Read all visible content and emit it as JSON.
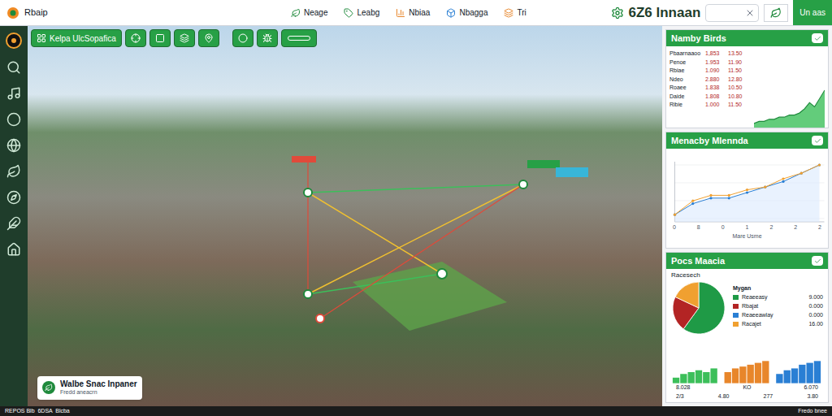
{
  "app": {
    "logo": "Rbaip"
  },
  "nav_tabs": [
    {
      "label": "Neage",
      "selected": false,
      "color": "#1f8a3c"
    },
    {
      "label": "Leabg",
      "selected": false,
      "color": "#1f8a3c"
    },
    {
      "label": "Nbiaa",
      "selected": false,
      "color": "#e8862a"
    },
    {
      "label": "Nbagga",
      "selected": false,
      "color": "#2a7fd4"
    },
    {
      "label": "Tri",
      "selected": false,
      "color": "#e8862a"
    }
  ],
  "header": {
    "title": "6Z6 lnnaan",
    "search": {
      "value": ""
    },
    "button": "Un aas"
  },
  "toolbar": {
    "primary": "Kelpa UlcSopafica"
  },
  "map_card": {
    "title": "Walbe Snac Inpaner",
    "subtitle": "Fredd aneacrn"
  },
  "card_table": {
    "title": "Namby Birds",
    "rows": [
      [
        "Pbaarnaaoo",
        "1,853",
        "13.50"
      ],
      [
        "Penoe",
        "1.953",
        "11.90"
      ],
      [
        "Rbiae",
        "1.090",
        "11.50"
      ],
      [
        "Ndeo",
        "2.880",
        "12.80"
      ],
      [
        "Roaee",
        "1.838",
        "10.50"
      ],
      [
        "Daide",
        "1.808",
        "10.80"
      ],
      [
        "Ribie",
        "1.000",
        "11.50"
      ]
    ],
    "series": [
      2,
      3,
      3,
      4,
      4,
      5,
      5,
      6,
      6,
      7,
      9,
      12,
      10,
      14,
      18
    ]
  },
  "card_line": {
    "title": "Menacby Mlennda",
    "x_ticks": [
      "0",
      "8",
      "0",
      "1",
      "2",
      "2",
      "2"
    ],
    "x_label": "Mare Usme",
    "series": [
      {
        "values": [
          1,
          3,
          4,
          4,
          5,
          6,
          7,
          8.5,
          10
        ],
        "color": "#2a7fd4"
      },
      {
        "values": [
          1,
          3.5,
          4.5,
          4.5,
          5.5,
          6,
          7.5,
          8.5,
          10
        ],
        "color": "#f0a030"
      }
    ]
  },
  "card_pie": {
    "title": "Pocs Maacia",
    "subtitle": "Racesech",
    "legend_title": "Mygan",
    "slices": [
      {
        "label": "Reaeeasy",
        "value": "9.000",
        "share": 60,
        "color": "#1f9a46"
      },
      {
        "label": "Rbajat",
        "value": "0.000",
        "share": 22,
        "color": "#b32424"
      },
      {
        "label": "Reaeeawlay",
        "value": "0.000",
        "share": 0,
        "color": "#2a7fd4"
      },
      {
        "label": "Racajet",
        "value": "16.00",
        "share": 18,
        "color": "#f0a030"
      }
    ],
    "bars": [
      {
        "color": "#3cbf5a",
        "values": [
          3,
          5,
          6,
          7,
          6,
          8
        ]
      },
      {
        "color": "#e8862a",
        "values": [
          6,
          8,
          9,
          10,
          11,
          12
        ]
      },
      {
        "color": "#2a7fd4",
        "values": [
          5,
          7,
          8,
          10,
          11,
          12
        ]
      }
    ],
    "labels_top": [
      "8.028",
      "KO",
      "6.070"
    ],
    "labels_bottom": [
      "2/3",
      "4.80",
      "277",
      "3.80"
    ]
  },
  "status_bar": {
    "left": "REPOS Blb  6DSA  Blcba",
    "right": "Fredo bnee"
  }
}
